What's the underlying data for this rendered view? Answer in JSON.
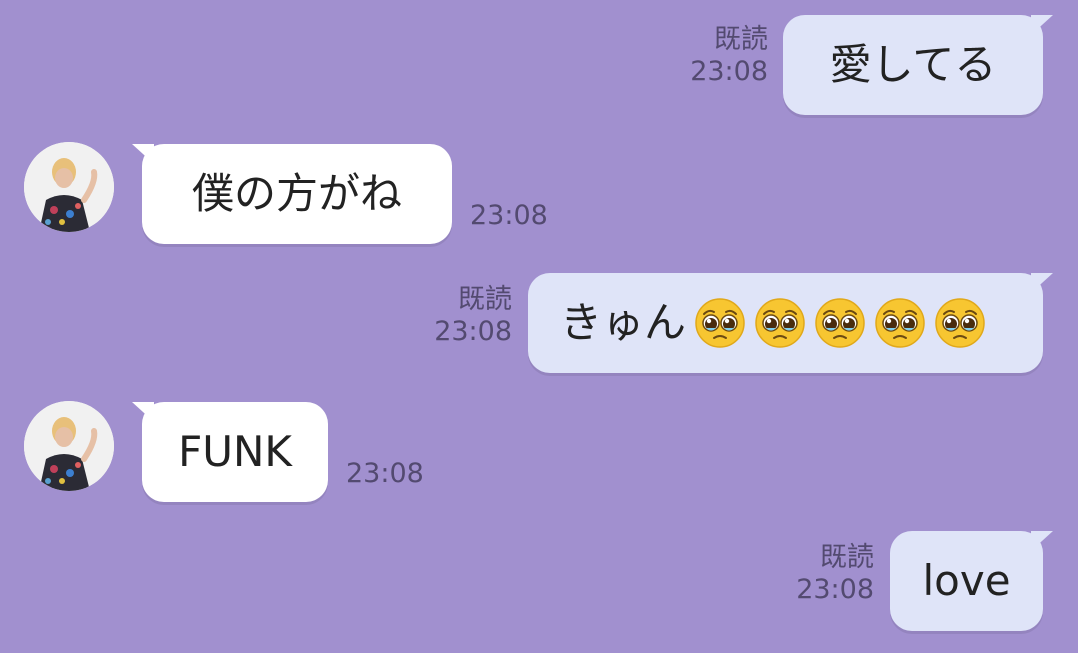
{
  "messages": [
    {
      "direction": "out",
      "text": "愛してる",
      "read": "既読",
      "time": "23:08"
    },
    {
      "direction": "in",
      "text": "僕の方がね",
      "time": "23:08"
    },
    {
      "direction": "out",
      "text": "きゅん",
      "emoji_count": 5,
      "emoji": "pleading-face-icon",
      "read": "既読",
      "time": "23:08"
    },
    {
      "direction": "in",
      "text": "FUNK",
      "time": "23:08"
    },
    {
      "direction": "out",
      "text": "love",
      "read": "既読",
      "time": "23:08"
    }
  ],
  "colors": {
    "background": "#a190cf",
    "outgoing_bubble": "#dfe4f8",
    "incoming_bubble": "#ffffff",
    "meta_text": "#534a70"
  }
}
